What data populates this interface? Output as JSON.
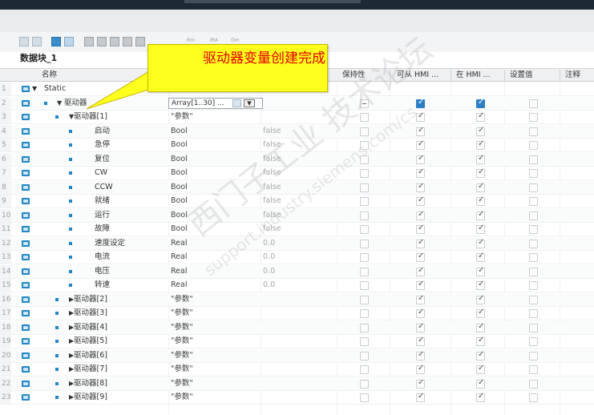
{
  "editor": {
    "block_title": "数据块_1",
    "toolbar_small": [
      "Rm",
      "IRA",
      "Om"
    ]
  },
  "columns": {
    "name": "名称",
    "retain": "保持性",
    "hmi_access": "可从 HMI ...",
    "hmi_visible": "在 HMI ...",
    "setpoint": "设置值",
    "comment": "注释"
  },
  "callout": {
    "text": "驱动器变量创建完成"
  },
  "combo": {
    "value": "Array[1..30] ..."
  },
  "watermark": {
    "line1": "西门子工业 技术论坛",
    "line2": "support.industry.siemens.com/cs"
  },
  "rows": [
    {
      "num": "1",
      "name": "Static",
      "type": "",
      "default": "",
      "level": 0,
      "expander": "down",
      "retain": "none",
      "hmi_access": "none",
      "hmi_visible": "none",
      "setpoint": "none"
    },
    {
      "num": "2",
      "name": "驱动器",
      "type": "",
      "default": "",
      "level": 1,
      "expander": "down",
      "retain": "dash",
      "hmi_access": "blue",
      "hmi_visible": "blue",
      "setpoint": "off",
      "combo": true
    },
    {
      "num": "3",
      "name": "驱动器[1]",
      "type": "\"参数\"",
      "default": "",
      "level": 2,
      "expander": "down",
      "retain": "off",
      "hmi_access": "on",
      "hmi_visible": "on",
      "setpoint": "off"
    },
    {
      "num": "4",
      "name": "启动",
      "type": "Bool",
      "default": "false",
      "level": 3,
      "expander": "",
      "retain": "off",
      "hmi_access": "on",
      "hmi_visible": "on",
      "setpoint": "off"
    },
    {
      "num": "5",
      "name": "急停",
      "type": "Bool",
      "default": "false",
      "level": 3,
      "expander": "",
      "retain": "off",
      "hmi_access": "on",
      "hmi_visible": "on",
      "setpoint": "off"
    },
    {
      "num": "6",
      "name": "复位",
      "type": "Bool",
      "default": "false",
      "level": 3,
      "expander": "",
      "retain": "off",
      "hmi_access": "on",
      "hmi_visible": "on",
      "setpoint": "off"
    },
    {
      "num": "7",
      "name": "CW",
      "type": "Bool",
      "default": "false",
      "level": 3,
      "expander": "",
      "retain": "off",
      "hmi_access": "on",
      "hmi_visible": "on",
      "setpoint": "off"
    },
    {
      "num": "8",
      "name": "CCW",
      "type": "Bool",
      "default": "false",
      "level": 3,
      "expander": "",
      "retain": "off",
      "hmi_access": "on",
      "hmi_visible": "on",
      "setpoint": "off"
    },
    {
      "num": "9",
      "name": "就绪",
      "type": "Bool",
      "default": "false",
      "level": 3,
      "expander": "",
      "retain": "off",
      "hmi_access": "on",
      "hmi_visible": "on",
      "setpoint": "off"
    },
    {
      "num": "10",
      "name": "运行",
      "type": "Bool",
      "default": "false",
      "level": 3,
      "expander": "",
      "retain": "off",
      "hmi_access": "on",
      "hmi_visible": "on",
      "setpoint": "off"
    },
    {
      "num": "11",
      "name": "故障",
      "type": "Bool",
      "default": "false",
      "level": 3,
      "expander": "",
      "retain": "off",
      "hmi_access": "on",
      "hmi_visible": "on",
      "setpoint": "off"
    },
    {
      "num": "12",
      "name": "速度设定",
      "type": "Real",
      "default": "0.0",
      "level": 3,
      "expander": "",
      "retain": "off",
      "hmi_access": "on",
      "hmi_visible": "on",
      "setpoint": "off"
    },
    {
      "num": "13",
      "name": "电流",
      "type": "Real",
      "default": "0.0",
      "level": 3,
      "expander": "",
      "retain": "off",
      "hmi_access": "on",
      "hmi_visible": "on",
      "setpoint": "off"
    },
    {
      "num": "14",
      "name": "电压",
      "type": "Real",
      "default": "0.0",
      "level": 3,
      "expander": "",
      "retain": "off",
      "hmi_access": "on",
      "hmi_visible": "on",
      "setpoint": "off"
    },
    {
      "num": "15",
      "name": "转速",
      "type": "Real",
      "default": "0.0",
      "level": 3,
      "expander": "",
      "retain": "off",
      "hmi_access": "on",
      "hmi_visible": "on",
      "setpoint": "off"
    },
    {
      "num": "16",
      "name": "驱动器[2]",
      "type": "\"参数\"",
      "default": "",
      "level": 2,
      "expander": "right",
      "retain": "off",
      "hmi_access": "on",
      "hmi_visible": "on",
      "setpoint": "off"
    },
    {
      "num": "17",
      "name": "驱动器[3]",
      "type": "\"参数\"",
      "default": "",
      "level": 2,
      "expander": "right",
      "retain": "off",
      "hmi_access": "on",
      "hmi_visible": "on",
      "setpoint": "off"
    },
    {
      "num": "18",
      "name": "驱动器[4]",
      "type": "\"参数\"",
      "default": "",
      "level": 2,
      "expander": "right",
      "retain": "off",
      "hmi_access": "on",
      "hmi_visible": "on",
      "setpoint": "off"
    },
    {
      "num": "19",
      "name": "驱动器[5]",
      "type": "\"参数\"",
      "default": "",
      "level": 2,
      "expander": "right",
      "retain": "off",
      "hmi_access": "on",
      "hmi_visible": "on",
      "setpoint": "off"
    },
    {
      "num": "20",
      "name": "驱动器[6]",
      "type": "\"参数\"",
      "default": "",
      "level": 2,
      "expander": "right",
      "retain": "off",
      "hmi_access": "on",
      "hmi_visible": "on",
      "setpoint": "off"
    },
    {
      "num": "21",
      "name": "驱动器[7]",
      "type": "\"参数\"",
      "default": "",
      "level": 2,
      "expander": "right",
      "retain": "off",
      "hmi_access": "on",
      "hmi_visible": "on",
      "setpoint": "off"
    },
    {
      "num": "22",
      "name": "驱动器[8]",
      "type": "\"参数\"",
      "default": "",
      "level": 2,
      "expander": "right",
      "retain": "off",
      "hmi_access": "on",
      "hmi_visible": "on",
      "setpoint": "off"
    },
    {
      "num": "23",
      "name": "驱动器[9]",
      "type": "\"参数\"",
      "default": "",
      "level": 2,
      "expander": "right",
      "retain": "off",
      "hmi_access": "on",
      "hmi_visible": "on",
      "setpoint": "off"
    }
  ]
}
